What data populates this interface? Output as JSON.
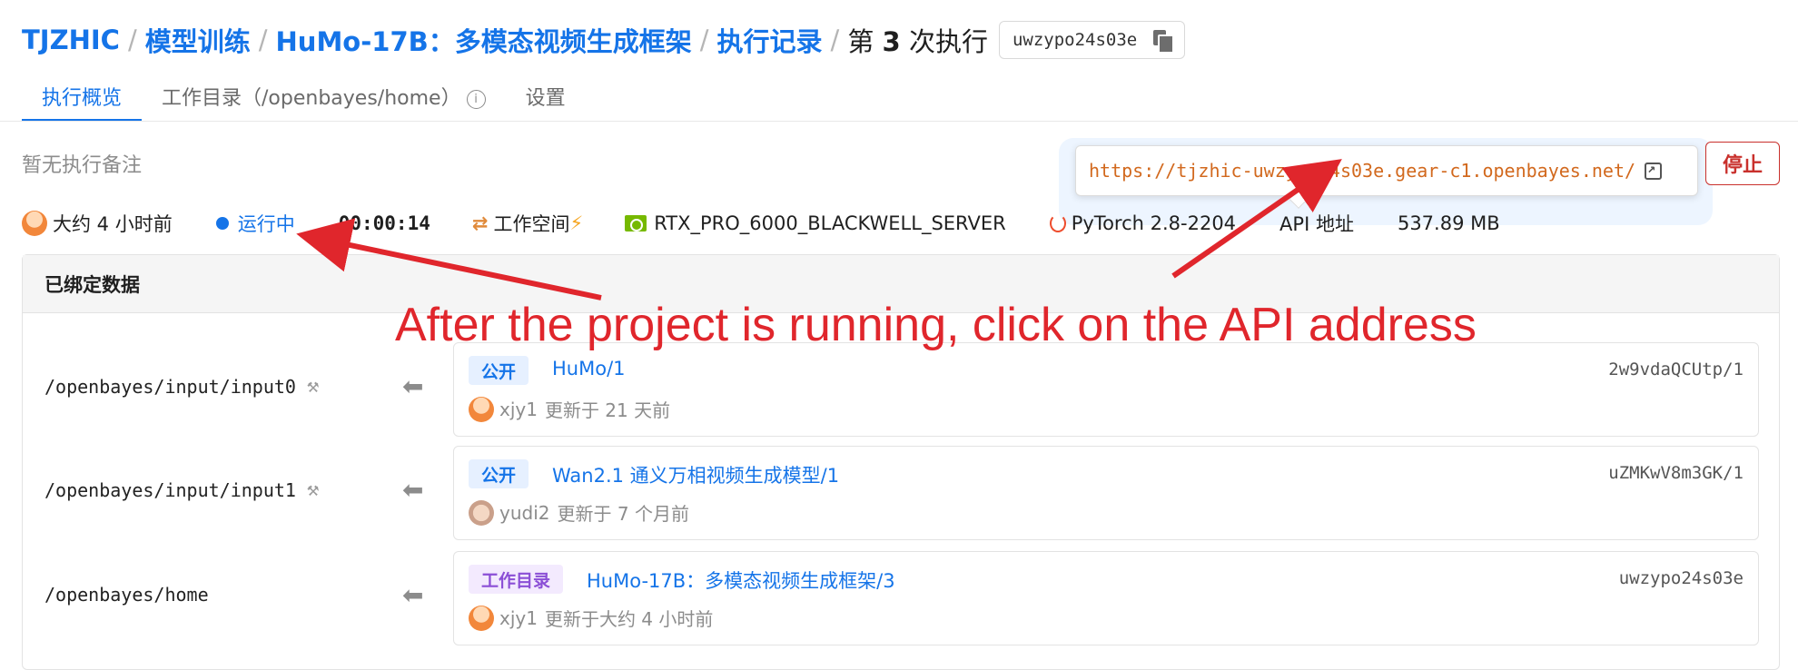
{
  "breadcrumb": {
    "items": [
      "TJZHIC",
      "模型训练",
      "HuMo-17B：多模态视频生成框架",
      "执行记录"
    ],
    "separator": "/",
    "current_prefix": "第",
    "current_number": "3",
    "current_suffix": "次执行",
    "run_id": "uwzypo24s03e"
  },
  "tabs": [
    {
      "label": "执行概览",
      "active": true
    },
    {
      "label": "工作目录（/openbayes/home）",
      "active": false
    },
    {
      "label": "设置",
      "active": false
    }
  ],
  "note": "暂无执行备注",
  "api_popover": {
    "url": "https://tjzhic-uwzypo24s03e.gear-c1.openbayes.net/"
  },
  "stop_button": "停止",
  "status": {
    "time_ago": "大约 4 小时前",
    "state": "运行中",
    "duration": "00:00:14",
    "workspace": "工作空间",
    "gpu": "RTX_PRO_6000_BLACKWELL_SERVER",
    "framework": "PyTorch 2.8-2204",
    "api_label": "API 地址",
    "size": "537.89 MB"
  },
  "bound_data": {
    "title": "已绑定数据",
    "rows": [
      {
        "path": "/openbayes/input/input0",
        "badge": "公开",
        "badge_type": "public",
        "name": "HuMo/1",
        "id": "2w9vdaQCUtp/1",
        "user": "xjy1",
        "updated": "更新于 21 天前"
      },
      {
        "path": "/openbayes/input/input1",
        "badge": "公开",
        "badge_type": "public",
        "name": "Wan2.1 通义万相视频生成模型/1",
        "id": "uZMKwV8m3GK/1",
        "user": "yudi2",
        "updated": "更新于 7 个月前"
      },
      {
        "path": "/openbayes/home",
        "badge": "工作目录",
        "badge_type": "workdir",
        "name": "HuMo-17B：多模态视频生成框架/3",
        "id": "uwzypo24s03e",
        "user": "xjy1",
        "updated": "更新于大约 4 小时前"
      }
    ]
  },
  "annotation": {
    "text": "After the project is running, click on the API address",
    "color": "#e0262c"
  },
  "colors": {
    "primary": "#1574e8",
    "danger": "#c9302c",
    "url": "#d2691e"
  }
}
